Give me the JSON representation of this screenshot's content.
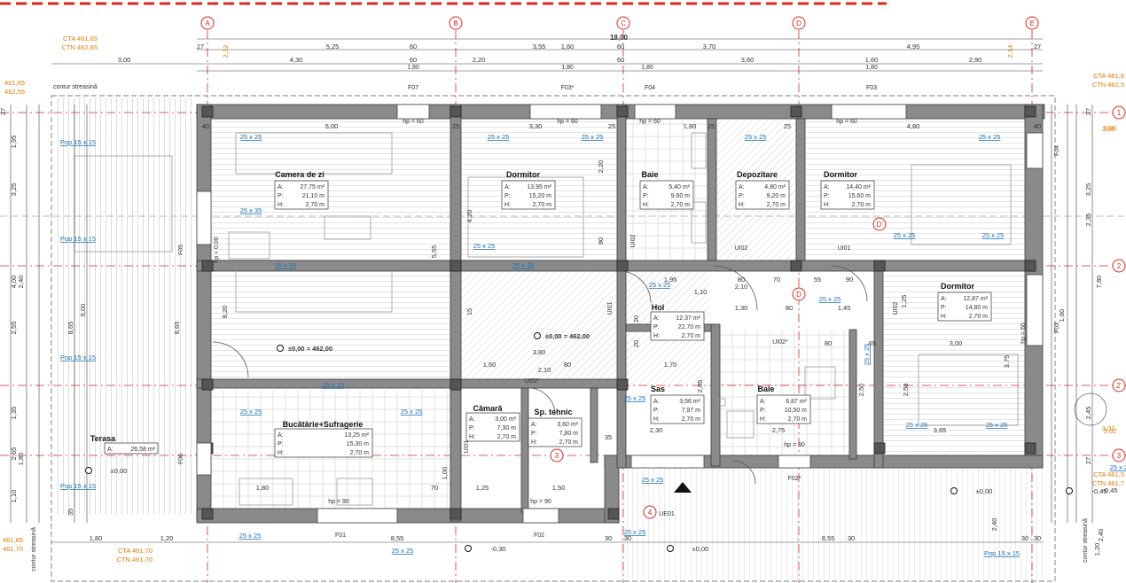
{
  "colors": {
    "wall": "#8a8a8a",
    "wall_edge": "#3a3a3a",
    "axis": "#e0261f",
    "annotation": "#e07b00",
    "link": "#1a73b8",
    "dim": "#333333",
    "hatch": "#b8b8b8",
    "furniture": "#9a9a9a"
  },
  "axes": {
    "vertical": [
      "A",
      "B",
      "C",
      "D",
      "E"
    ],
    "horizontal": [
      "1",
      "2",
      "2'",
      "3"
    ],
    "extra": [
      "D'",
      "D",
      "3",
      "4"
    ]
  },
  "dims": {
    "overall": "18,00",
    "top_row1": [
      "27",
      "5,25",
      "60",
      "3,55",
      "1,60",
      "60",
      "3,70",
      "4,95",
      "27"
    ],
    "top_row2": [
      "3,00",
      "4,30",
      "60",
      "2,20",
      "60",
      "3,60",
      "1,60",
      "2,90"
    ],
    "top_row2b": [
      "1,80",
      "1,80",
      "1,80",
      "1,80"
    ],
    "left": [
      "1,95",
      "3,25",
      "4,00",
      "2,40",
      "2,55",
      "8,65",
      "9,00",
      "8,65",
      "1,35",
      "2,65",
      "1,80",
      "1,10",
      "27",
      "35"
    ],
    "right": [
      "27",
      "3,00",
      "3,25",
      "7,80",
      "2,35",
      "1,60",
      "2,45",
      "3,02",
      "27",
      "2,40"
    ],
    "bottom": [
      "1,80",
      "1,20",
      "8,55",
      "30",
      "30",
      "8,55",
      "30",
      "30",
      "1,20"
    ],
    "levels": [
      "3,00",
      "3,02",
      "-0,45",
      "2,14",
      "2,32"
    ]
  },
  "eaves": {
    "label": "contur streasină"
  },
  "level_tags": [
    {
      "cta": "CTA 461,65",
      "ctn": "CTN 462,65"
    },
    {
      "cta": "461,65",
      "ctn": "462,55"
    },
    {
      "cta": "CTA 461,6",
      "ctn": "CTN 462,5"
    },
    {
      "cta": "CTA 461,5",
      "ctn": "CTN 461,7"
    },
    {
      "cta": "CTA 461,70",
      "ctn": "CTN 461,70"
    },
    {
      "cta": "461,65",
      "ctn": "461,70"
    }
  ],
  "rooms": [
    {
      "name": "Camera de zi",
      "a": "27,75 m²",
      "p": "21,10 m",
      "h": "2,70 m"
    },
    {
      "name": "Dormitor",
      "a": "13,95 m²",
      "p": "15,20 m",
      "h": "2,70 m"
    },
    {
      "name": "Baie",
      "a": "5,40 m²",
      "p": "9,60 m",
      "h": "2,70 m"
    },
    {
      "name": "Depozitare",
      "a": "4,80 m²",
      "p": "9,20 m",
      "h": "2,70 m"
    },
    {
      "name": "Dormitor",
      "a": "14,40 m²",
      "p": "15,60 m",
      "h": "2,70 m"
    },
    {
      "name": "Dormitor",
      "a": "12,87 m²",
      "p": "14,80 m",
      "h": "2,70 m"
    },
    {
      "name": "Hol",
      "a": "12,37 m²",
      "p": "22,70 m",
      "h": "2,70 m"
    },
    {
      "name": "Sas",
      "a": "3,56 m²",
      "p": "7,97 m",
      "h": "2,70 m"
    },
    {
      "name": "Baie",
      "a": "6,87 m²",
      "p": "10,50 m",
      "h": "2,70 m"
    },
    {
      "name": "Cămară",
      "a": "3,00 m²",
      "p": "7,30 m",
      "h": "2,70 m"
    },
    {
      "name": "Sp. tehnic",
      "a": "3,60 m²",
      "p": "7,80 m",
      "h": "2,70 m"
    },
    {
      "name": "Bucătărie+Sufragerie",
      "a": "13,25 m²",
      "p": "15,30 m",
      "h": "2,70 m"
    }
  ],
  "terrace": {
    "name": "Terasa",
    "a": "26,58 m²"
  },
  "room_keys": {
    "a": "A:",
    "p": "P:",
    "h": "H:"
  },
  "openings": [
    "F07",
    "F03*",
    "F04",
    "F03",
    "F04",
    "F05",
    "F06",
    "F03",
    "F01",
    "F02",
    "F02*",
    "UE01",
    "UI02*",
    "UI02",
    "UI01",
    "UI01",
    "UI02",
    "UI02*",
    "UI01",
    "UI02"
  ],
  "parapets": [
    "hp = 60",
    "hp = 60",
    "hp = 60",
    "hp = 60",
    "hp = 0,00",
    "hp = 60",
    "hp = 90",
    "hp = 90",
    "hp = 90"
  ],
  "columns": [
    "25 x 25",
    "25 x 25",
    "25 x 25",
    "25 x 25",
    "25 x 25",
    "25 x 35",
    "25 x 35",
    "25 x 35",
    "25 x 25",
    "25 x 25",
    "25 x 25",
    "25 x 25",
    "25 x 25",
    "25 x 25",
    "25 x 25",
    "25 x 25",
    "25 x 25",
    "25 x 25",
    "25 x 25",
    "25 x 25",
    "25 x 25",
    "25 x 25",
    "25 x 25",
    "25 x 25",
    "25 x 25"
  ],
  "pillars": [
    "Pop 15 x 15",
    "Pop 15 x 15",
    "Pop 15 x 15",
    "Pop 15 x 15",
    "Pop 15 x 15"
  ],
  "levels": [
    "±0,00 = 462,00",
    "±0,00 = 462,00",
    "±0,00",
    "±0,00",
    "±0,00",
    "-0,30",
    "-0,45"
  ],
  "inner_dims": [
    "40",
    "5,00",
    "25",
    "3,30",
    "25",
    "1,80",
    "25",
    "4,80",
    "25",
    "40",
    "2,20",
    "4,20",
    "5,55",
    "8,20",
    "80",
    "1,95",
    "80",
    "70",
    "55",
    "90",
    "2,10",
    "1,10",
    "1,30",
    "80",
    "1,45",
    "20",
    "1,25",
    "3,00",
    "80",
    "65",
    "3,80",
    "2,10",
    "1,60",
    "80",
    "1,70",
    "3,75",
    "2,85",
    "2,50",
    "2,58",
    "2,30",
    "2,75",
    "3,65",
    "1,80",
    "1,00",
    "1,25",
    "1,50",
    "70",
    "35",
    "2,40",
    "15",
    "20",
    "30"
  ]
}
